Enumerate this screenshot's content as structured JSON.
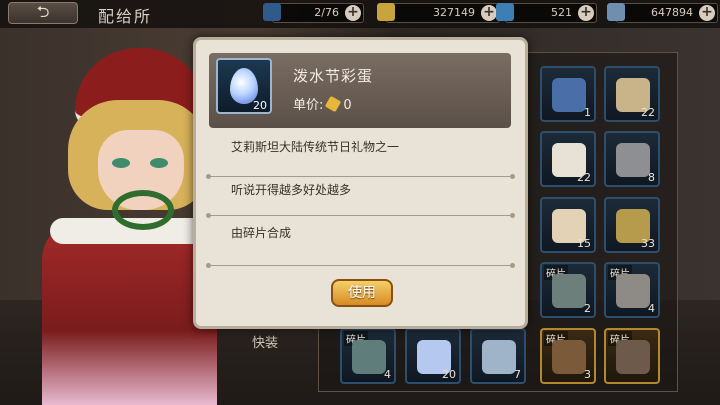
{
  "header": {
    "title": "配给所"
  },
  "resources": [
    {
      "value": "2/76",
      "icon": "lightning-icon"
    },
    {
      "value": "327149",
      "icon": "gold-cube-icon"
    },
    {
      "value": "521",
      "icon": "blue-gem-icon"
    },
    {
      "value": "647894",
      "icon": "crystal-icon"
    }
  ],
  "inventory": {
    "slots": [
      {
        "count": "1",
        "tag": ""
      },
      {
        "count": "22",
        "tag": ""
      },
      {
        "count": "22",
        "tag": ""
      },
      {
        "count": "8",
        "tag": ""
      },
      {
        "count": "15",
        "tag": ""
      },
      {
        "count": "33",
        "tag": ""
      },
      {
        "count": "2",
        "tag": "碎片"
      },
      {
        "count": "4",
        "tag": "碎片"
      },
      {
        "count": "4",
        "tag": "碎片"
      },
      {
        "count": "20",
        "tag": ""
      },
      {
        "count": "7",
        "tag": ""
      },
      {
        "count": "3",
        "tag": "碎片"
      },
      {
        "count": "",
        "tag": "碎片"
      }
    ],
    "fast_label": "快装"
  },
  "detail": {
    "item_name": "泼水节彩蛋",
    "item_count": "20",
    "price_label": "单价:",
    "price_value": "0",
    "lines": [
      "艾莉斯坦大陆传统节日礼物之一",
      "听说开得越多好处越多",
      "由碎片合成"
    ],
    "use_button": "使用"
  }
}
